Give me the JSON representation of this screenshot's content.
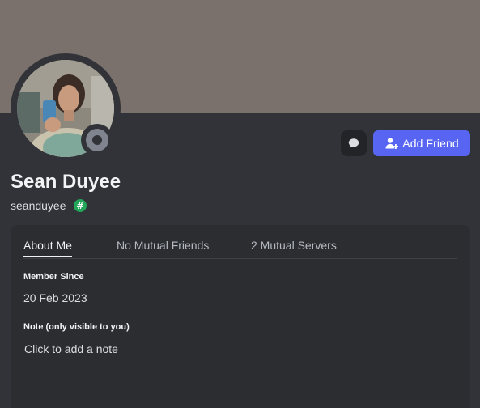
{
  "profile": {
    "display_name": "Sean Duyee",
    "username": "seanduyee",
    "badge_symbol": "#",
    "status": "offline",
    "banner_color": "#7a716c"
  },
  "actions": {
    "message_icon": "chat-bubble-icon",
    "add_friend_label": "Add Friend",
    "add_friend_icon": "add-person-icon",
    "accent": "#5865f2"
  },
  "tabs": [
    {
      "label": "About Me",
      "active": true
    },
    {
      "label": "No Mutual Friends",
      "active": false
    },
    {
      "label": "2 Mutual Servers",
      "active": false
    }
  ],
  "about": {
    "member_since_title": "Member Since",
    "member_since_value": "20 Feb 2023",
    "note_title": "Note (only visible to you)",
    "note_placeholder": "Click to add a note"
  }
}
